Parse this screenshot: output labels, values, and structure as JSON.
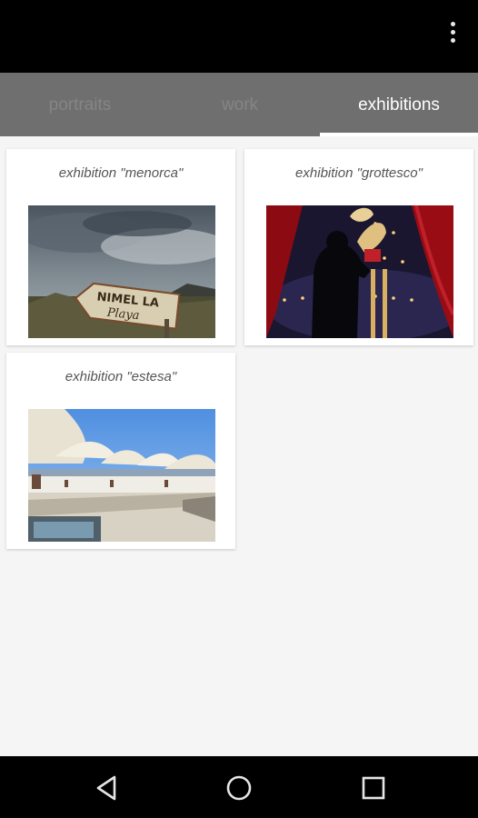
{
  "tabs": [
    {
      "label": "portraits"
    },
    {
      "label": "work"
    },
    {
      "label": "exhibitions"
    }
  ],
  "exhibitions": [
    {
      "title": "exhibition \"menorca\"",
      "image": "sign-photo"
    },
    {
      "title": "exhibition \"grottesco\"",
      "image": "circus-photo"
    },
    {
      "title": "exhibition \"estesa\"",
      "image": "umbrellas-photo"
    }
  ],
  "colors": {
    "tabbar": "#6f6f6f",
    "active_tab": "#ffffff",
    "inactive_tab": "#858585",
    "background": "#f5f5f5"
  }
}
